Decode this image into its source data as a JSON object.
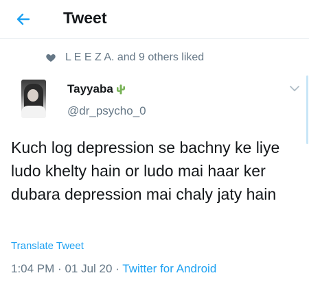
{
  "header": {
    "title": "Tweet",
    "back_icon": "arrow-left-icon",
    "accent": "#1da1f2"
  },
  "social_context": {
    "icon": "heart-icon",
    "text": "L E E Z A. and 9 others liked"
  },
  "tweet": {
    "author": {
      "display_name": "Tayyaba",
      "name_emoji": "cactus-icon",
      "handle": "@dr_psycho_0"
    },
    "text": "Kuch log depression se bachny ke liye ludo khelty hain or ludo mai haar ker dubara depression mai chaly jaty hain",
    "translate_label": "Translate Tweet",
    "time": "1:04 PM",
    "date": "01 Jul 20",
    "separator": "·",
    "source": "Twitter for Android"
  },
  "colors": {
    "text_primary": "#14171a",
    "text_secondary": "#657786",
    "link": "#1da1f2",
    "divider": "#e6ecf0"
  }
}
